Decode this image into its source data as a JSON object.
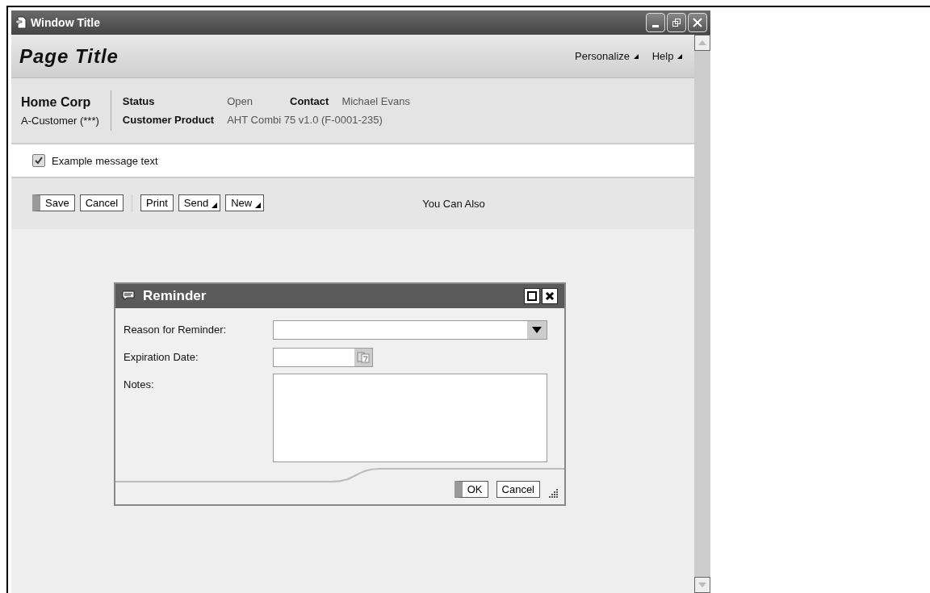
{
  "window": {
    "title": "Window Title"
  },
  "page_title": "Page Title",
  "header_links": [
    {
      "label": "Personalize"
    },
    {
      "label": "Help"
    }
  ],
  "header": {
    "company": "Home Corp",
    "customer_type": "A-Customer (***)",
    "fields": [
      {
        "label": "Status",
        "value": "Open"
      },
      {
        "label": "Contact",
        "value": "Michael Evans"
      },
      {
        "label": "Customer Product",
        "value": "AHT Combi 75 v1.0 (F-0001-235)"
      }
    ]
  },
  "message": {
    "text": "Example message text",
    "checked": true
  },
  "toolbar": {
    "buttons": [
      {
        "label": "Save",
        "kind": "primary"
      },
      {
        "label": "Cancel",
        "kind": "plain"
      },
      {
        "label": "Print",
        "kind": "plain",
        "separated": true
      },
      {
        "label": "Send",
        "kind": "menu"
      },
      {
        "label": "New",
        "kind": "menu"
      }
    ],
    "also": "You Can Also"
  },
  "dialog": {
    "title": "Reminder",
    "fields": [
      {
        "label": "Reason for Reminder:",
        "kind": "dropdown"
      },
      {
        "label": "Expiration Date:",
        "kind": "date"
      },
      {
        "label": "Notes:",
        "kind": "textarea"
      }
    ],
    "buttons": [
      {
        "label": "OK",
        "kind": "primary"
      },
      {
        "label": "Cancel",
        "kind": "plain"
      }
    ]
  }
}
